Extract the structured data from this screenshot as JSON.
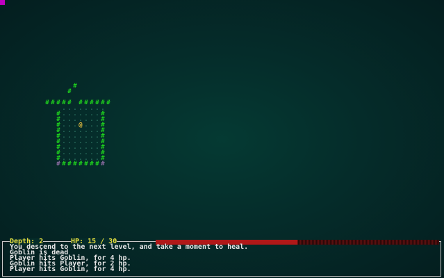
{
  "status": {
    "depth_text": "Depth: 2",
    "hp_text": "HP: 15 / 30",
    "hp_current": 15,
    "hp_max": 30
  },
  "log": [
    "You descend to the next level, and take a moment to heal.",
    "Goblin is dead",
    "Player hits Goblin, for 4 hp.",
    "Goblin hits Player, for 2 hp.",
    "Player hits Goblin, for 4 hp."
  ],
  "glyphs": {
    "wall": "#",
    "floor": ".",
    "player": "@"
  },
  "colors": {
    "wall": "#1ecf1e",
    "floor": "#2a6e5e",
    "player": "#e8c040",
    "hp_bar": "#b01818",
    "background": "#052c2a"
  }
}
